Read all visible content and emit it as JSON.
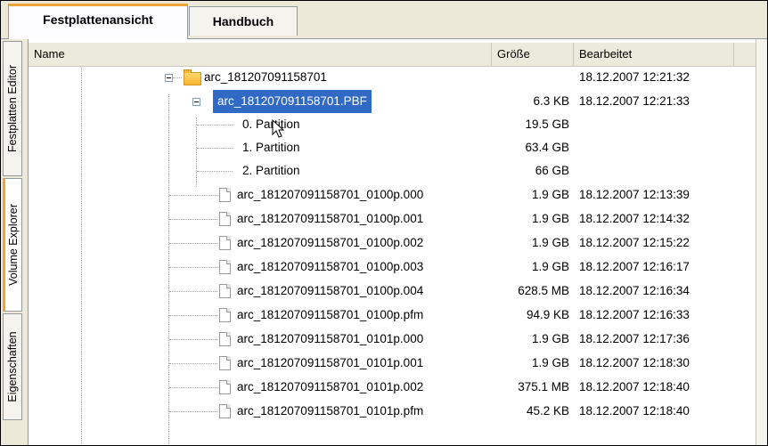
{
  "tabs": [
    "Festplattenansicht",
    "Handbuch"
  ],
  "side_tabs": [
    "Festplatten Editor",
    "Volume Explorer",
    "Eigenschaften"
  ],
  "columns": {
    "name": "Name",
    "size": "Größe",
    "modified": "Bearbeitet"
  },
  "tree": {
    "root": {
      "name": "arc_181207091158701",
      "modified": "18.12.2007 12:21:32"
    },
    "pbf": {
      "name": "arc_181207091158701.PBF",
      "size": "6.3 KB",
      "modified": "18.12.2007 12:21:33"
    },
    "partitions": [
      {
        "name": "0. Partition",
        "size": "19.5 GB"
      },
      {
        "name": "1. Partition",
        "size": "63.4 GB"
      },
      {
        "name": "2. Partition",
        "size": "66 GB"
      }
    ],
    "files": [
      {
        "name": "arc_181207091158701_0100p.000",
        "size": "1.9 GB",
        "modified": "18.12.2007 12:13:39"
      },
      {
        "name": "arc_181207091158701_0100p.001",
        "size": "1.9 GB",
        "modified": "18.12.2007 12:14:32"
      },
      {
        "name": "arc_181207091158701_0100p.002",
        "size": "1.9 GB",
        "modified": "18.12.2007 12:15:22"
      },
      {
        "name": "arc_181207091158701_0100p.003",
        "size": "1.9 GB",
        "modified": "18.12.2007 12:16:17"
      },
      {
        "name": "arc_181207091158701_0100p.004",
        "size": "628.5 MB",
        "modified": "18.12.2007 12:16:34"
      },
      {
        "name": "arc_181207091158701_0100p.pfm",
        "size": "94.9 KB",
        "modified": "18.12.2007 12:16:33"
      },
      {
        "name": "arc_181207091158701_0101p.000",
        "size": "1.9 GB",
        "modified": "18.12.2007 12:17:36"
      },
      {
        "name": "arc_181207091158701_0101p.001",
        "size": "1.9 GB",
        "modified": "18.12.2007 12:18:30"
      },
      {
        "name": "arc_181207091158701_0101p.002",
        "size": "375.1 MB",
        "modified": "18.12.2007 12:18:40"
      },
      {
        "name": "arc_181207091158701_0101p.pfm",
        "size": "45.2 KB",
        "modified": "18.12.2007 12:18:40"
      }
    ]
  },
  "colors": {
    "selection": "#316ac5",
    "active_tab_accent": "#f2a43a",
    "chrome": "#ece9d8"
  },
  "icons": [
    "folder-icon",
    "file-icon",
    "expand-collapse-icon",
    "mouse-pointer-icon"
  ]
}
